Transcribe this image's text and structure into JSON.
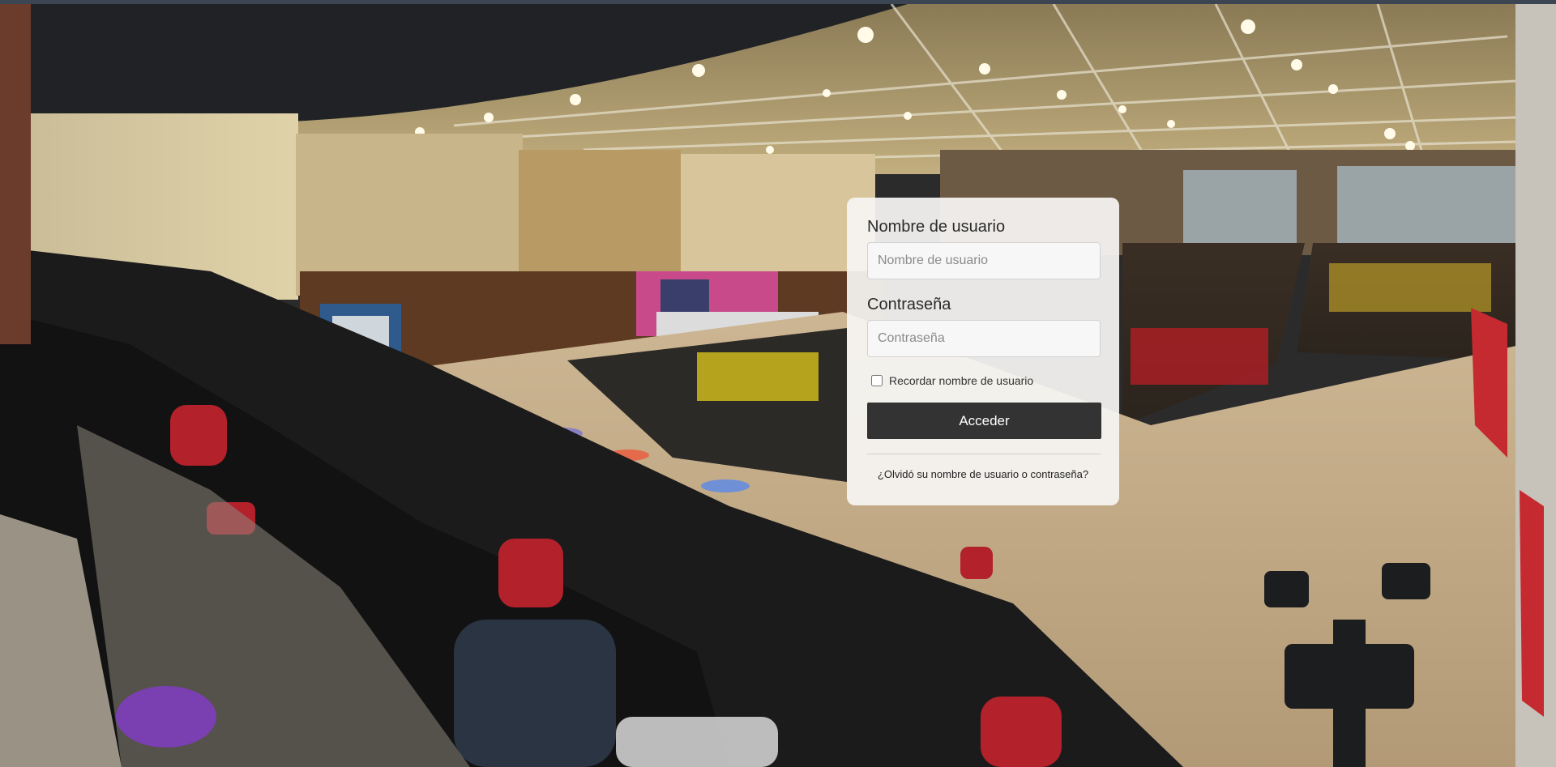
{
  "login": {
    "username_label": "Nombre de usuario",
    "username_placeholder": "Nombre de usuario",
    "password_label": "Contraseña",
    "password_placeholder": "Contraseña",
    "remember_label": "Recordar nombre de usuario",
    "remember_checked": false,
    "submit_label": "Acceder",
    "forgot_link": "¿Olvidó su nombre de usuario o contraseña?"
  },
  "colors": {
    "button_bg": "#333333",
    "card_bg": "#f6f5f3",
    "top_bar": "#3c4652"
  }
}
